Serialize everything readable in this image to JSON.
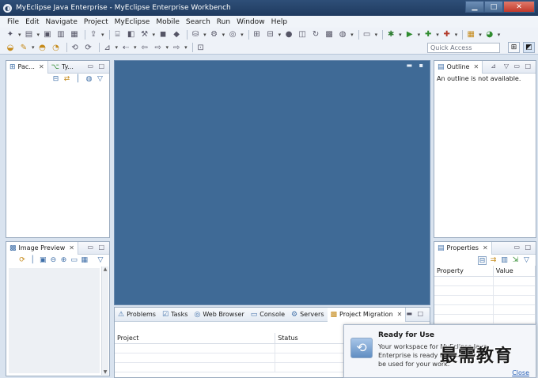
{
  "window": {
    "title": "MyEclipse Java Enterprise - MyEclipse Enterprise Workbench",
    "app_icon": "myeclipse-logo"
  },
  "menu": [
    "File",
    "Edit",
    "Navigate",
    "Project",
    "MyEclipse",
    "Mobile",
    "Search",
    "Run",
    "Window",
    "Help"
  ],
  "toolbar": {
    "quick_access_placeholder": "Quick Access"
  },
  "views": {
    "package_explorer_tab": "Pac...",
    "type_hierarchy_tab": "Ty...",
    "outline_tab": "Outline",
    "outline_message": "An outline is not available.",
    "image_preview_tab": "Image Preview",
    "properties_tab": "Properties",
    "properties_columns": [
      "Property",
      "Value"
    ]
  },
  "bottom_panel": {
    "tabs": [
      "Problems",
      "Tasks",
      "Web Browser",
      "Console",
      "Servers",
      "Project Migration"
    ],
    "columns": [
      "Project",
      "Status"
    ]
  },
  "notification": {
    "title": "Ready for Use",
    "text": "Your workspace for MyEclipse Java Enterprise is ready for use and can be used for your work.",
    "close": "Close"
  },
  "watermark": "最需教育",
  "colors": {
    "editor_area": "#3f6a96",
    "title_bar": "#1f3a5f",
    "accent": "#3f6fa8"
  }
}
